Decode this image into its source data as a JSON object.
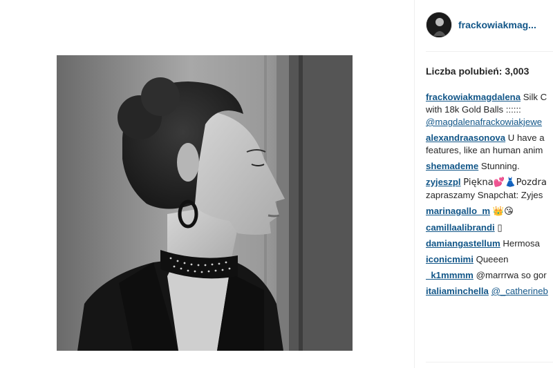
{
  "header": {
    "username": "frackowiakmag..."
  },
  "likes": {
    "text": "Liczba polubień: 3,003"
  },
  "comments": [
    {
      "user": "frackowiakmagdalena",
      "lines": [
        "Silk C",
        "with 18k Gold Balls ::::::",
        "@magdalenafrackowiakjewe"
      ]
    },
    {
      "user": "alexandraasonova",
      "lines": [
        "U have a",
        "features, like an human anim"
      ]
    },
    {
      "user": "shemademe",
      "lines": [
        "Stunning."
      ]
    },
    {
      "user": "zyjeszpl",
      "lines": [
        "Piękna💕👗Pozdra",
        "zapraszamy Snapchat: Zyjes"
      ]
    },
    {
      "user": "marinagallo_m",
      "lines": [
        "👑😘"
      ]
    },
    {
      "user": "camillaalibrandi",
      "lines": [
        "▯"
      ]
    },
    {
      "user": "damiangastellum",
      "lines": [
        "Hermosa"
      ]
    },
    {
      "user": "iconicmimi",
      "lines": [
        "Queeen"
      ]
    },
    {
      "user": "_k1mmmm",
      "lines": [
        "@marrrwa so gor"
      ]
    },
    {
      "user": "italiaminchella",
      "lines": [
        "@_catherineb"
      ]
    }
  ]
}
